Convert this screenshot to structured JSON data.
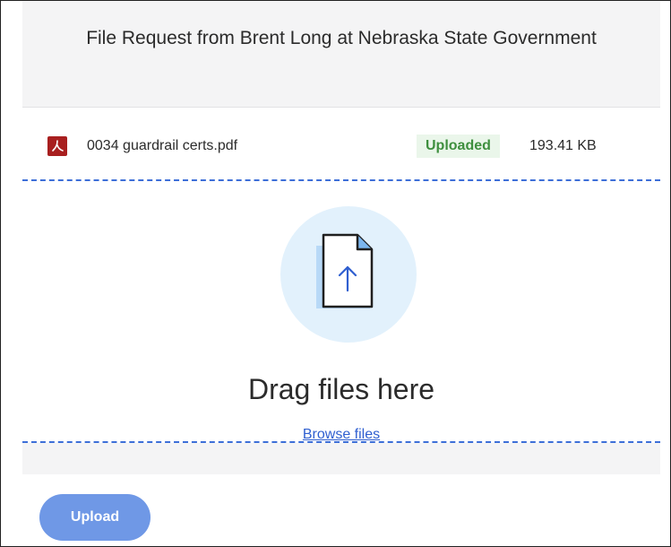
{
  "header": {
    "title": "File Request from Brent Long at Nebraska State Government"
  },
  "files": [
    {
      "icon": "pdf-icon",
      "name": "0034 guardrail certs.pdf",
      "status": "Uploaded",
      "size": "193.41 KB"
    }
  ],
  "dropzone": {
    "icon": "upload-document-icon",
    "drag_text": "Drag files here",
    "browse_label": "Browse files"
  },
  "actions": {
    "upload_label": "Upload"
  },
  "colors": {
    "accent": "#6f98e6",
    "link": "#2f5fd0",
    "pdf": "#a81f1f",
    "status_green": "#3e8f3e",
    "status_bg": "#eaf6ea",
    "dropzone_border": "#3d6fd8",
    "circle_bg": "#e2f1fc"
  }
}
